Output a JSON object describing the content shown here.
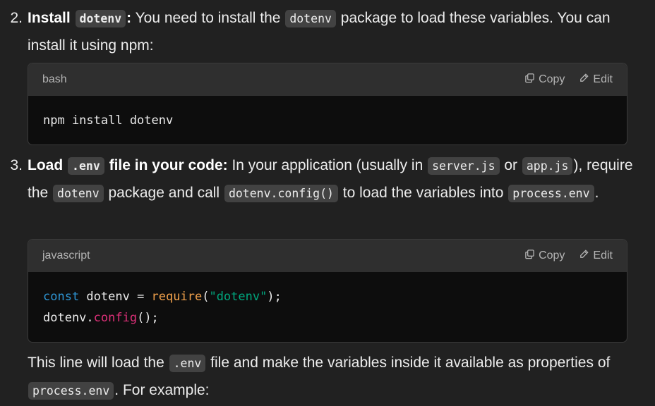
{
  "step2": {
    "number": "2.",
    "bold_prefix": "Install",
    "bold_code": "dotenv",
    "bold_suffix": ":",
    "text1": " You need to install the ",
    "code1": "dotenv",
    "text2": " package to load these variables. You can install it using npm:"
  },
  "codeblock1": {
    "language": "bash",
    "copy_label": "Copy",
    "edit_label": "Edit",
    "line1": "npm install dotenv"
  },
  "step3": {
    "number": "3.",
    "bold_prefix": "Load",
    "bold_code": ".env",
    "bold_suffix": " file in your code:",
    "text1": " In your application (usually in ",
    "code1": "server.js",
    "text2": " or ",
    "code2": "app.js",
    "text3": "), require the ",
    "code3": "dotenv",
    "text4": " package and call ",
    "code4": "dotenv.config()",
    "text5": " to load the variables into ",
    "code5": "process.env",
    "text6": "."
  },
  "codeblock2": {
    "language": "javascript",
    "copy_label": "Copy",
    "edit_label": "Edit",
    "l1_kw": "const",
    "l1_a": " dotenv = ",
    "l1_fn": "require",
    "l1_b": "(",
    "l1_str": "\"dotenv\"",
    "l1_c": ");",
    "l2_a": "dotenv.",
    "l2_prop": "config",
    "l2_b": "();"
  },
  "para": {
    "text1": "This line will load the ",
    "code1": ".env",
    "text2": " file and make the variables inside it available as properties of ",
    "code2": "process.env",
    "text3": ". For example:"
  },
  "colors": {
    "background": "#212121",
    "code_background": "#0d0d0d",
    "code_header": "#2f2f2f",
    "inline_code": "#424242",
    "keyword": "#2e95d3",
    "function": "#f0a04b",
    "string": "#00a67d",
    "property": "#df3079"
  }
}
